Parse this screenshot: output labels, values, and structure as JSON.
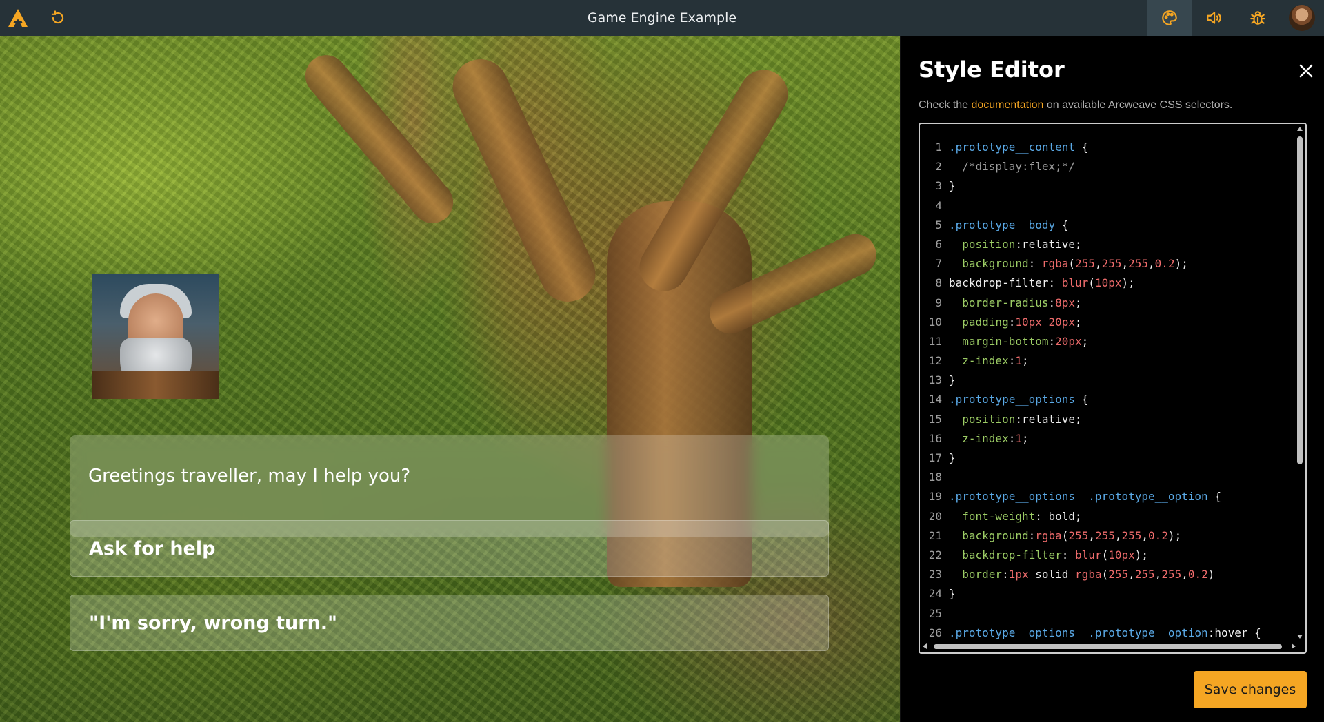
{
  "app": {
    "title": "Game Engine Example"
  },
  "topbar": {
    "icons": [
      "arcweave-logo-icon",
      "reset-icon",
      "palette-icon",
      "sound-icon",
      "bug-icon",
      "avatar"
    ]
  },
  "game": {
    "dialog_text": "Greetings traveller, may I help you?",
    "options": [
      "Ask for help",
      "\"I'm sorry, wrong turn.\""
    ]
  },
  "editor": {
    "title": "Style Editor",
    "hint_before": "Check the ",
    "hint_link": "documentation",
    "hint_after": " on available Arcweave CSS selectors.",
    "save_label": "Save changes",
    "code_lines": [
      ".prototype__content {",
      "  /*display:flex;*/",
      "}",
      "",
      ".prototype__body {",
      "  position:relative;",
      "  background: rgba(255,255,255,0.2);",
      "backdrop-filter: blur(10px);",
      "  border-radius:8px;",
      "  padding:10px 20px;",
      "  margin-bottom:20px;",
      "  z-index:1;",
      "}",
      ".prototype__options {",
      "  position:relative;",
      "  z-index:1;",
      "}",
      "",
      ".prototype__options  .prototype__option {",
      "  font-weight: bold;",
      "  background:rgba(255,255,255,0.2);",
      "  backdrop-filter: blur(10px);",
      "  border:1px solid rgba(255,255,255,0.2)",
      "}",
      "",
      ".prototype__options  .prototype__option:hover {"
    ]
  },
  "colors": {
    "accent": "#f5a623",
    "topbar": "#263238",
    "selector": "#5aa9e6",
    "property": "#9ccc65",
    "number": "#ef6c6c"
  }
}
